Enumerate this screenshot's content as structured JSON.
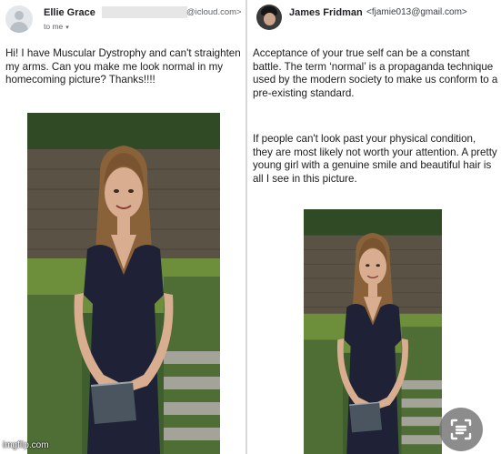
{
  "left_email": {
    "sender_name": "Ellie Grace",
    "sender_email_visible": "@icloud.com>",
    "recipient_label": "to me",
    "caret": "▾",
    "body": "Hi! I have Muscular Dystrophy and can't straighten my arms. Can you make me look normal in my homecoming picture? Thanks!!!!"
  },
  "right_email": {
    "sender_name": "James Fridman",
    "sender_email": "<fjamie013@gmail.com>",
    "paragraph_1": "Acceptance of your true self can be a constant battle. The term ‘normal’ is a propaganda technique used by the modern society to make us conform to a pre-existing standard.",
    "paragraph_2": "If people can't look past your physical condition, they are most likely not worth your attention. A pretty young girl with a genuine smile and beautiful hair is all I see in this picture."
  },
  "overlay": {
    "watermark": "imgflip.com"
  },
  "colors": {
    "dress": "#1f2137",
    "hair": "#8a6239",
    "skin": "#d9ad8f",
    "fence": "#5b5246",
    "foliage": "#3f5e2e",
    "lawn": "#6d8f3c"
  },
  "icons": {
    "left_avatar": "default-person-icon",
    "right_avatar": "profile-photo",
    "scan_button": "lens-scan-icon"
  }
}
